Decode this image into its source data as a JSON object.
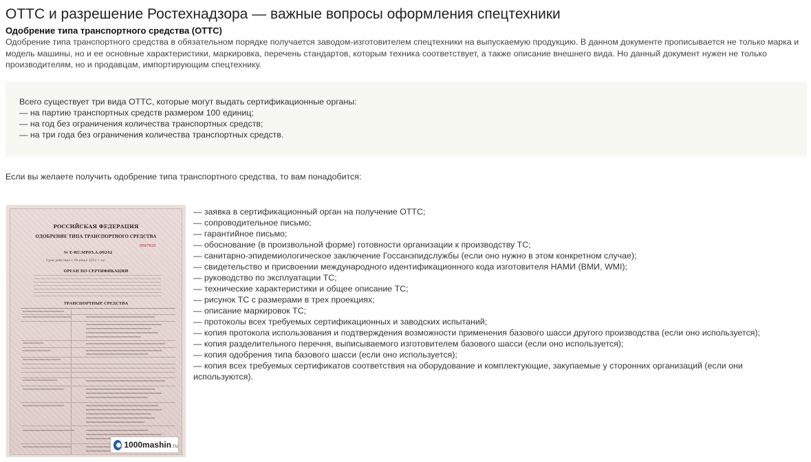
{
  "title": "ОТТС и разрешение Ростехнадзора — важные вопросы оформления спецтехники",
  "subtitle": "Одобрение типа транспортного средства (ОТТС)",
  "intro": "Одобрение типа транспортного средства в обязательном порядке получается заводом-изготовителем спецтехники на выпускаемую продукцию. В данном документе прописывается не только марка и модель машины, но и ее основные характеристики, маркировка, перечень стандартов, которым техника соответствует, а также описание внешнего вида. Но данный документ нужен не только производителям, но и продавцам, импортирующим спецтехнику.",
  "note": {
    "lead": "Всего существует три вида ОТТС, которые могут выдать сертификационные органы:",
    "items": [
      "— на партию транспортных средств размером 100 единиц;",
      "— на год без ограничения количества транспортных средств;",
      "— на три года без ограничения количества транспортных средств."
    ]
  },
  "need_intro": "Если вы желаете получить одобрение типа транспортного средства, то вам понадобится:",
  "document_image": {
    "country": "РОССИЙСКАЯ ФЕДЕРАЦИЯ",
    "doc_type": "ОДОБРЕНИЕ ТИПА ТРАНСПОРТНОГО СРЕДСТВА",
    "serial": "0007038",
    "number": "№ Е-RU.МР05.А.00242",
    "term": "Срок действия с  08 июня 2012 г.  по",
    "organ": "ОРГАН ПО СЕРТИФИКАЦИИ",
    "section": "ТРАНСПОРТНЫЕ СРЕДСТВА",
    "watermark": "1000mashin",
    "watermark_suffix": ".ru"
  },
  "requirements": [
    "— заявка в сертификационный орган на получение ОТТС;",
    "— сопроводительное письмо;",
    "— гарантийное письмо;",
    "— обоснование (в произвольной форме) готовности организации к производству ТС;",
    "— санитарно-эпидемиологическое заключение Госсанэпидслужбы (если оно нужно в этом конкретном случае);",
    "— свидетельство и присвоении международного идентификационного кода изготовителя НАМИ (ВМИ, WMI);",
    "— руководство по эксплуатации ТС;",
    "— технические характеристики и общее описание ТС;",
    "— рисунок ТС с размерами в трех проекциях;",
    "— описание маркировок ТС;",
    "— протоколы всех требуемых сертификационных и заводских испытаний;",
    "— копия протокола использования и подтверждения возможности применения базового шасси другого производства (если оно используется);",
    "— копия разделительного перечня, выписываемого изготовителем базового шасси (если оно используется);",
    "— копия одобрения типа базового шасси (если оно используется);",
    "— копия всех требуемых сертификатов соответствия на оборудование и комплектующие, закупаемые у сторонних организаций (если они используются)."
  ]
}
